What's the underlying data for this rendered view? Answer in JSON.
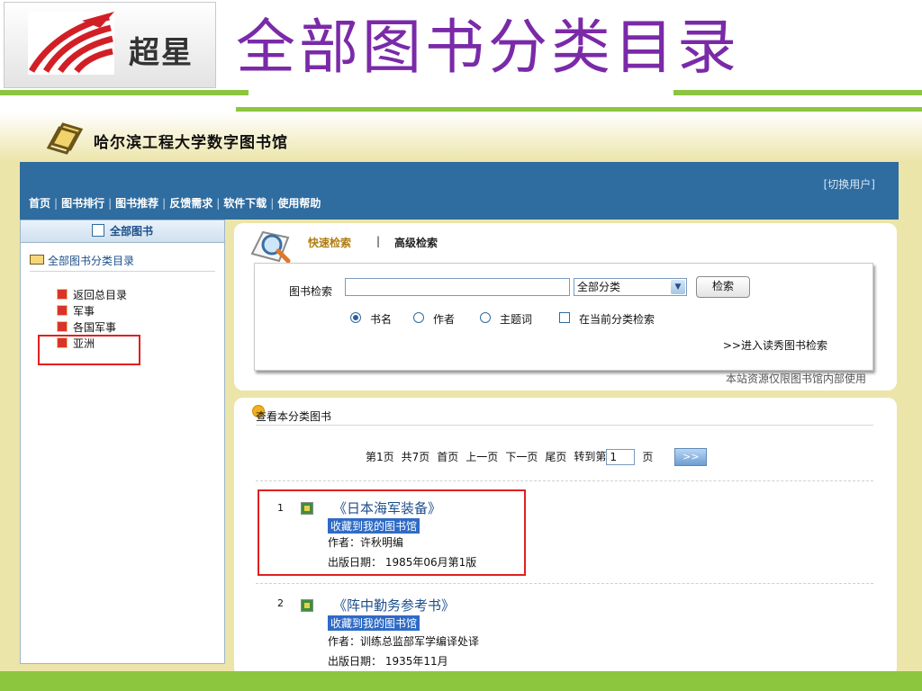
{
  "slide": {
    "logo_text": "超星",
    "title": "全部图书分类目录",
    "accent_color": "#8cc63f",
    "title_color": "#7a2aa8"
  },
  "site": {
    "title": "哈尔滨工程大学数字图书馆",
    "switch_user": "[切换用户]",
    "nav": [
      "首页",
      "图书排行",
      "图书推荐",
      "反馈需求",
      "软件下载",
      "使用帮助"
    ],
    "navbar_color": "#2f6c9f"
  },
  "sidebar": {
    "tab_label": "全部图书",
    "root_label": "全部图书分类目录",
    "items": [
      {
        "label": "返回总目录"
      },
      {
        "label": "军事"
      },
      {
        "label": "各国军事"
      },
      {
        "label": "亚洲"
      }
    ]
  },
  "search": {
    "quick_label": "快速检索",
    "divider": "|",
    "advanced_label": "高级检索",
    "field_label": "图书检索",
    "input_value": "",
    "category_value": "全部分类",
    "button_label": "检索",
    "options": [
      "书名",
      "作者",
      "主题词"
    ],
    "selected_option": "书名",
    "current_category_label": "在当前分类检索",
    "xiuread_link": ">>进入读秀图书检索",
    "note": "本站资源仅限图书馆内部使用"
  },
  "results": {
    "header": "查看本分类图书",
    "pager": {
      "current": "第1页",
      "total": "共7页",
      "first": "首页",
      "prev": "上一页",
      "next": "下一页",
      "last": "尾页",
      "goto_prefix": "转到第",
      "goto_value": "1",
      "goto_suffix": "页",
      "go_button": ">>"
    },
    "books": [
      {
        "num": "1",
        "title": "《日本海军装备》",
        "fav": "收藏到我的图书馆",
        "author": "作者：许秋明编",
        "date": "出版日期：  1985年06月第1版"
      },
      {
        "num": "2",
        "title": "《阵中勤务参考书》",
        "fav": "收藏到我的图书馆",
        "author": "作者：训练总监部军学编译处译",
        "date": "出版日期：  1935年11月"
      }
    ]
  }
}
